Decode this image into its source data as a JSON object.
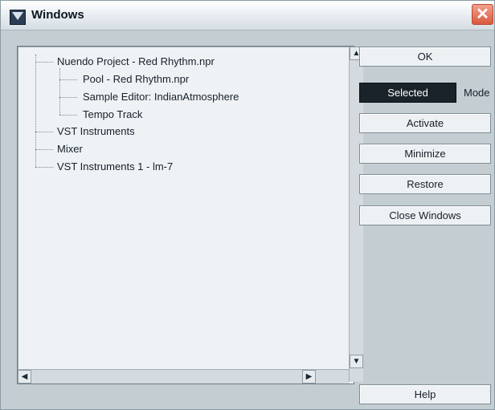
{
  "window": {
    "title": "Windows",
    "close_glyph": "✕"
  },
  "tree": {
    "items": [
      {
        "label": "Nuendo Project - Red Rhythm.npr",
        "level": 0
      },
      {
        "label": "Pool - Red Rhythm.npr",
        "level": 1
      },
      {
        "label": "Sample Editor: IndianAtmosphere",
        "level": 1
      },
      {
        "label": "Tempo Track",
        "level": 1
      },
      {
        "label": "VST Instruments",
        "level": 0
      },
      {
        "label": "Mixer",
        "level": 0
      },
      {
        "label": "VST Instruments 1 - lm-7",
        "level": 0
      }
    ],
    "scroll_up_glyph": "▲",
    "scroll_down_glyph": "▼",
    "scroll_left_glyph": "◀",
    "scroll_right_glyph": "▶"
  },
  "buttons": {
    "ok": "OK",
    "mode_value": "Selected",
    "mode_label": "Mode",
    "activate": "Activate",
    "minimize": "Minimize",
    "restore": "Restore",
    "close_windows": "Close Windows",
    "help": "Help"
  },
  "colors": {
    "selected_mode_bg": "#1b232a",
    "close_button": "#d9593d"
  }
}
